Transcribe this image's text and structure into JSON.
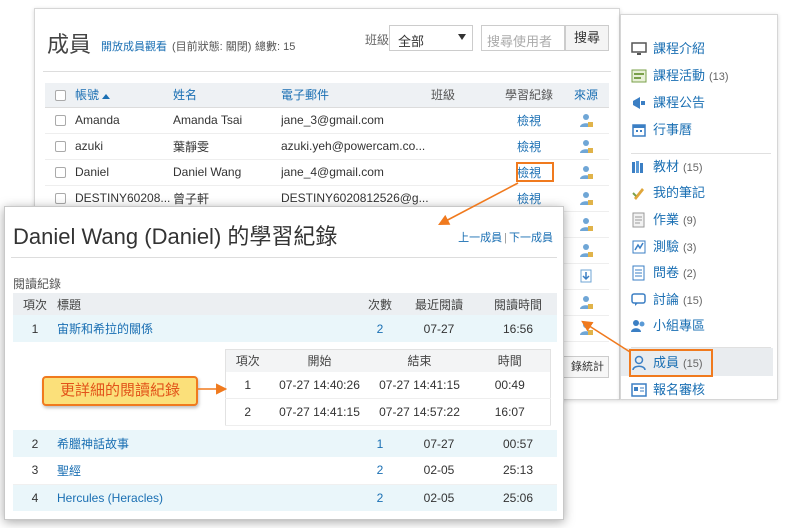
{
  "members": {
    "title": "成員",
    "open_link": "開放成員觀看",
    "status_text": "(目前狀態: 關閉)",
    "total_text": "總數: 15",
    "class_label": "班級",
    "class_selected": "全部",
    "search_placeholder": "搜尋使用者",
    "search_button": "搜尋",
    "stats_button": "錄統計",
    "columns": [
      "帳號",
      "姓名",
      "電子郵件",
      "班級",
      "學習紀錄",
      "來源"
    ],
    "rows": [
      {
        "account": "Amanda",
        "name": "Amanda Tsai",
        "email": "jane_3@gmail.com",
        "class": "",
        "record": "檢視"
      },
      {
        "account": "azuki",
        "name": "葉靜雯",
        "email": "azuki.yeh@powercam.co...",
        "class": "",
        "record": "檢視"
      },
      {
        "account": "Daniel",
        "name": "Daniel Wang",
        "email": "jane_4@gmail.com",
        "class": "",
        "record": "檢視"
      },
      {
        "account": "DESTINY60208...",
        "name": "曾子軒",
        "email": "DESTINY6020812526@g...",
        "class": "",
        "record": "檢視"
      }
    ]
  },
  "sidebar": {
    "items": [
      {
        "label": "課程介紹",
        "count": "",
        "icon": "monitor-icon"
      },
      {
        "label": "課程活動",
        "count": "(13)",
        "icon": "activity-icon"
      },
      {
        "label": "課程公告",
        "count": "",
        "icon": "megaphone-icon"
      },
      {
        "label": "行事曆",
        "count": "",
        "icon": "calendar-icon"
      },
      {
        "label": "教材",
        "count": "(15)",
        "icon": "books-icon"
      },
      {
        "label": "我的筆記",
        "count": "",
        "icon": "pencil-icon"
      },
      {
        "label": "作業",
        "count": "(9)",
        "icon": "assignment-icon"
      },
      {
        "label": "測驗",
        "count": "(3)",
        "icon": "quiz-icon"
      },
      {
        "label": "問卷",
        "count": "(2)",
        "icon": "survey-icon"
      },
      {
        "label": "討論",
        "count": "(15)",
        "icon": "discussion-icon"
      },
      {
        "label": "小組專區",
        "count": "",
        "icon": "group-icon"
      },
      {
        "label": "成員",
        "count": "(15)",
        "icon": "member-icon"
      },
      {
        "label": "報名審核",
        "count": "",
        "icon": "registration-icon"
      }
    ]
  },
  "record": {
    "title": "Daniel Wang (Daniel) 的學習紀錄",
    "prev_link": "上一成員",
    "next_link": "下一成員",
    "section": "閱讀紀錄",
    "columns": [
      "項次",
      "標題",
      "次數",
      "最近閱讀",
      "閱讀時間"
    ],
    "rows": [
      {
        "no": "1",
        "title": "宙斯和希拉的關係",
        "count": "2",
        "last": "07-27",
        "time": "16:56"
      },
      {
        "no": "2",
        "title": "希臘神話故事",
        "count": "1",
        "last": "07-27",
        "time": "00:57"
      },
      {
        "no": "3",
        "title": "聖經",
        "count": "2",
        "last": "02-05",
        "time": "25:13"
      },
      {
        "no": "4",
        "title": "Hercules (Heracles)",
        "count": "2",
        "last": "02-05",
        "time": "25:06"
      }
    ],
    "detail_columns": [
      "項次",
      "開始",
      "結束",
      "時間"
    ],
    "detail_rows": [
      {
        "no": "1",
        "start": "07-27 14:40:26",
        "end": "07-27 14:41:15",
        "time": "00:49"
      },
      {
        "no": "2",
        "start": "07-27 14:41:15",
        "end": "07-27 14:57:22",
        "time": "16:07"
      }
    ],
    "callout": "更詳細的閱讀紀錄"
  },
  "colors": {
    "accent": "#f07a1e",
    "link": "#1a6fb3",
    "callout_bg": "#fbe07a",
    "callout_text": "#e2531a"
  }
}
